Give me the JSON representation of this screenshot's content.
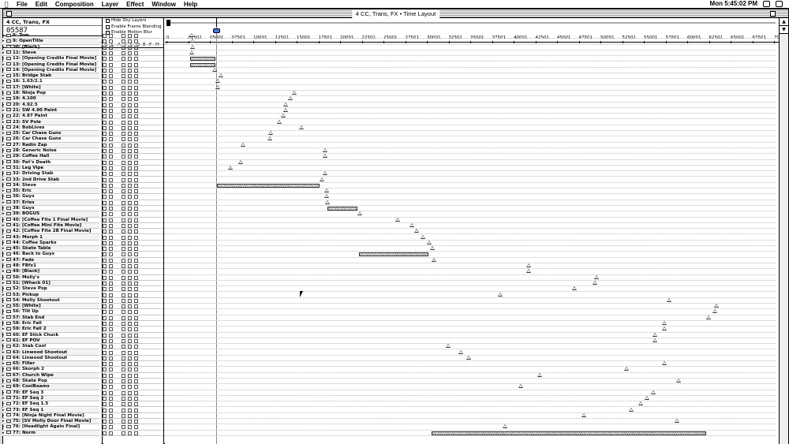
{
  "menubar": {
    "apple": "",
    "items": [
      "File",
      "Edit",
      "Composition",
      "Layer",
      "Effect",
      "Window",
      "Help"
    ],
    "clock": "Mon 5:45:02 PM"
  },
  "window": {
    "title": "4 CC, Trans, FX • Time Layout",
    "comp_tab": "4 CC, Trans, FX",
    "timecode": "05587",
    "layer_name_header": "Layer Name",
    "switch_header": [
      "S",
      "L",
      "A",
      "V",
      "C",
      "Q",
      "E",
      "F",
      "M"
    ],
    "options": [
      "Hide Shy Layers",
      "Enable Frame Blending",
      "Enable Motion Blur"
    ],
    "ruler_ticks": [
      "0",
      "02501",
      "05001",
      "07501",
      "10001",
      "12501",
      "15001",
      "17501",
      "20001",
      "22501",
      "25001",
      "27501",
      "30001",
      "32501",
      "35001",
      "37501",
      "40001",
      "42501",
      "45001",
      "47501",
      "50001",
      "52501",
      "55001",
      "57501",
      "60001",
      "62501",
      "65001",
      "67501",
      "7000"
    ]
  },
  "layers": [
    {
      "name": "8: Tom",
      "kf": [
        35
      ]
    },
    {
      "name": "9: OpenTitle",
      "kf": [
        36
      ]
    },
    {
      "name": "10: [Black]",
      "kf": [
        36
      ]
    },
    {
      "name": "11: Steve",
      "kf": [
        35
      ]
    },
    {
      "name": "12: [Opening Credits Final Movie]",
      "bar": [
        36,
        68
      ]
    },
    {
      "name": "13: [Opening Credits Final Movie]",
      "bar": [
        36,
        68
      ]
    },
    {
      "name": "14: [Opening Credits Final Movie]",
      "kf": [
        64
      ]
    },
    {
      "name": "15: Bridge Stab",
      "kf": [
        72
      ]
    },
    {
      "name": "16: 1.63/2.1",
      "kf": [
        68
      ]
    },
    {
      "name": "17: [White]",
      "kf": [
        68
      ]
    },
    {
      "name": "18: Ninja Pop",
      "kf": [
        165
      ]
    },
    {
      "name": "19: 4.100",
      "kf": [
        160
      ]
    },
    {
      "name": "20: 4.92.5",
      "kf": [
        154
      ]
    },
    {
      "name": "21: SW 4.90 Paint",
      "kf": [
        154
      ]
    },
    {
      "name": "22: 4.87 Paint",
      "kf": [
        151
      ]
    },
    {
      "name": "23: SV Pole",
      "kf": [
        146
      ]
    },
    {
      "name": "24: BobLives",
      "kf": [
        174
      ]
    },
    {
      "name": "25: Car Chase Guns",
      "kf": [
        135
      ]
    },
    {
      "name": "26: Car Chase Guns",
      "kf": [
        134
      ]
    },
    {
      "name": "27: Radio Zap",
      "kf": [
        100
      ]
    },
    {
      "name": "28: Generic Noise",
      "kf": [
        204
      ]
    },
    {
      "name": "29: Coffee Hall",
      "kf": [
        204
      ]
    },
    {
      "name": "30: Pat's Death",
      "kf": [
        97
      ]
    },
    {
      "name": "31: Leg Vipe",
      "kf": [
        84
      ]
    },
    {
      "name": "32: Driving Stab",
      "kf": [
        204
      ]
    },
    {
      "name": "33: 2nd Drive Stab",
      "kf": [
        200
      ]
    },
    {
      "name": "34: Steve",
      "bar": [
        70,
        200
      ]
    },
    {
      "name": "35: Eric",
      "kf": [
        206
      ]
    },
    {
      "name": "36: Guys",
      "kf": [
        206
      ]
    },
    {
      "name": "37: Eries",
      "kf": [
        207
      ]
    },
    {
      "name": "38: Guys",
      "bar": [
        210,
        248
      ]
    },
    {
      "name": "39: BOGUS",
      "kf": [
        248
      ]
    },
    {
      "name": "40: [Coffee Fite 1 Final Movie]",
      "kf": [
        296
      ]
    },
    {
      "name": "41: [Coffee Mini Fite Movie]",
      "kf": [
        314
      ]
    },
    {
      "name": "42: [Coffee Fite 2B Final Movie]",
      "kf": [
        320
      ]
    },
    {
      "name": "43: Morph 1",
      "kf": [
        328
      ]
    },
    {
      "name": "44: Coffee Sparks",
      "kf": [
        336
      ]
    },
    {
      "name": "45: Skate Table",
      "kf": [
        340
      ]
    },
    {
      "name": "46: Back to Guys",
      "bar": [
        250,
        338
      ]
    },
    {
      "name": "47: Fade",
      "kf": [
        342
      ]
    },
    {
      "name": "48: FBfx1",
      "kf": [
        462
      ]
    },
    {
      "name": "49: [Black]",
      "kf": [
        462
      ]
    },
    {
      "name": "50: Molly's",
      "kf": [
        548
      ]
    },
    {
      "name": "51: [Whack 01]",
      "kf": [
        546
      ]
    },
    {
      "name": "52: Steve Pop",
      "kf": [
        520
      ]
    },
    {
      "name": "53: Pickup",
      "kf": [
        426
      ]
    },
    {
      "name": "54: Molly Shootout",
      "kf": [
        640
      ]
    },
    {
      "name": "55: [White]",
      "kf": [
        700
      ]
    },
    {
      "name": "56: Tilt Up",
      "kf": [
        698
      ]
    },
    {
      "name": "57: Stab End",
      "kf": [
        690
      ]
    },
    {
      "name": "58: Eric Fall",
      "kf": [
        634
      ]
    },
    {
      "name": "59: Eric Fall 2",
      "kf": [
        634
      ]
    },
    {
      "name": "60: EF Stick Chuck",
      "kf": [
        622
      ]
    },
    {
      "name": "61: EF POV",
      "kf": [
        622
      ]
    },
    {
      "name": "62: Stab Cool",
      "kf": [
        360
      ]
    },
    {
      "name": "63: Linwood Shootout",
      "kf": [
        376
      ]
    },
    {
      "name": "64: Linwood Shootout",
      "kf": [
        386
      ]
    },
    {
      "name": "65: Filler",
      "kf": [
        634
      ]
    },
    {
      "name": "66: Skorph 2",
      "kf": [
        586
      ]
    },
    {
      "name": "67: Church Wipe",
      "kf": [
        476
      ]
    },
    {
      "name": "68: Skate Pop",
      "kf": [
        652
      ]
    },
    {
      "name": "69: CoolBeams",
      "kf": [
        452
      ]
    },
    {
      "name": "70: EF Seq 3",
      "kf": [
        620
      ]
    },
    {
      "name": "71: EF Seq 2",
      "kf": [
        612
      ]
    },
    {
      "name": "72: EF Seq 1.5",
      "kf": [
        604
      ]
    },
    {
      "name": "73: EF Seq 1",
      "kf": [
        592
      ]
    },
    {
      "name": "74: [Ninja Night Final Movie]",
      "kf": [
        532
      ]
    },
    {
      "name": "75: [SV Molly Door Final Movie]",
      "kf": [
        650
      ]
    },
    {
      "name": "76: [Headlight Again Final]",
      "kf": [
        432
      ]
    },
    {
      "name": "77: Norm",
      "bar": [
        342,
        690
      ]
    }
  ]
}
